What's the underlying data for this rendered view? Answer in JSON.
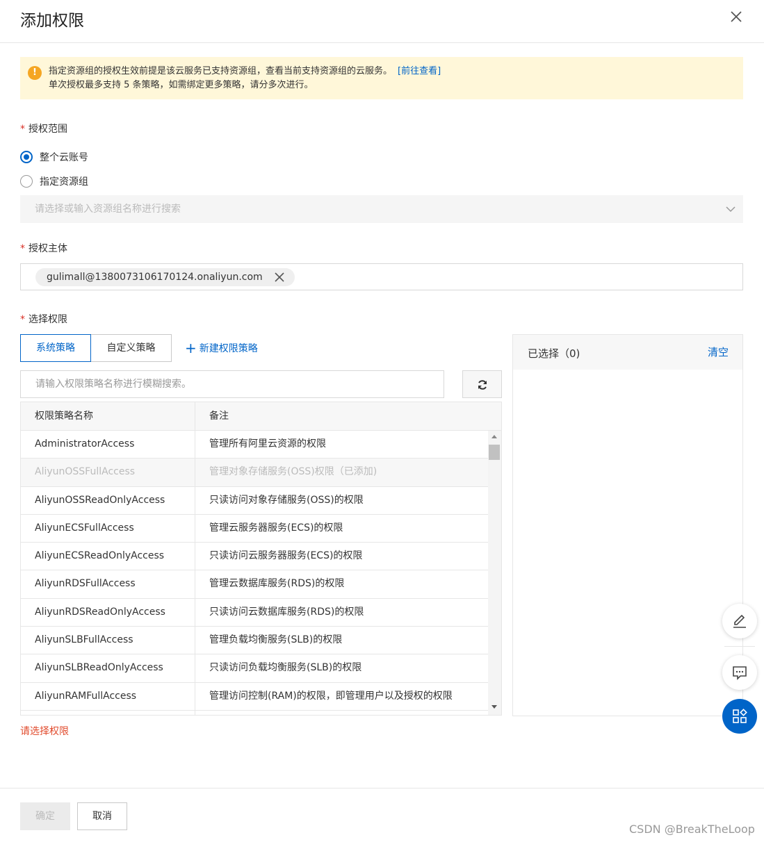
{
  "dialog": {
    "title": "添加权限"
  },
  "notice": {
    "line1": "指定资源组的授权生效前提是该云服务已支持资源组，查看当前支持资源组的云服务。",
    "link": "[前往查看]",
    "line2": "单次授权最多支持 5 条策略，如需绑定更多策略，请分多次进行。"
  },
  "scope": {
    "label": "授权范围",
    "options": [
      "整个云账号",
      "指定资源组"
    ],
    "selected": "整个云账号",
    "resource_group_placeholder": "请选择或输入资源组名称进行搜索"
  },
  "principal": {
    "label": "授权主体",
    "tag": "gulimall@1380073106170124.onaliyun.com"
  },
  "permissions": {
    "label": "选择权限",
    "tabs": [
      "系统策略",
      "自定义策略"
    ],
    "active_tab": "系统策略",
    "new_policy": "新建权限策略",
    "search_placeholder": "请输入权限策略名称进行模糊搜索。",
    "columns": [
      "权限策略名称",
      "备注"
    ],
    "rows": [
      {
        "name": "AdministratorAccess",
        "note": "管理所有阿里云资源的权限",
        "disabled": false
      },
      {
        "name": "AliyunOSSFullAccess",
        "note": "管理对象存储服务(OSS)权限（已添加)",
        "disabled": true
      },
      {
        "name": "AliyunOSSReadOnlyAccess",
        "note": "只读访问对象存储服务(OSS)的权限",
        "disabled": false
      },
      {
        "name": "AliyunECSFullAccess",
        "note": "管理云服务器服务(ECS)的权限",
        "disabled": false
      },
      {
        "name": "AliyunECSReadOnlyAccess",
        "note": "只读访问云服务器服务(ECS)的权限",
        "disabled": false
      },
      {
        "name": "AliyunRDSFullAccess",
        "note": "管理云数据库服务(RDS)的权限",
        "disabled": false
      },
      {
        "name": "AliyunRDSReadOnlyAccess",
        "note": "只读访问云数据库服务(RDS)的权限",
        "disabled": false
      },
      {
        "name": "AliyunSLBFullAccess",
        "note": "管理负载均衡服务(SLB)的权限",
        "disabled": false
      },
      {
        "name": "AliyunSLBReadOnlyAccess",
        "note": "只读访问负载均衡服务(SLB)的权限",
        "disabled": false
      },
      {
        "name": "AliyunRAMFullAccess",
        "note": "管理访问控制(RAM)的权限，即管理用户以及授权的权限",
        "disabled": false
      },
      {
        "name": "",
        "note": "",
        "disabled": false
      }
    ],
    "error": "请选择权限"
  },
  "selected_panel": {
    "title": "已选择（0)",
    "clear": "清空"
  },
  "footer": {
    "confirm": "确定",
    "cancel": "取消"
  },
  "watermark": "CSDN @BreakTheLoop",
  "icons": [
    "close-icon",
    "warning-icon",
    "chevron-down-icon",
    "tag-close-icon",
    "plus-icon",
    "refresh-icon",
    "edit-icon",
    "feedback-icon",
    "apps-icon"
  ],
  "colors": {
    "accent": "#0064c8",
    "warning_bg": "#fff7d9",
    "error": "#e14b2d"
  }
}
